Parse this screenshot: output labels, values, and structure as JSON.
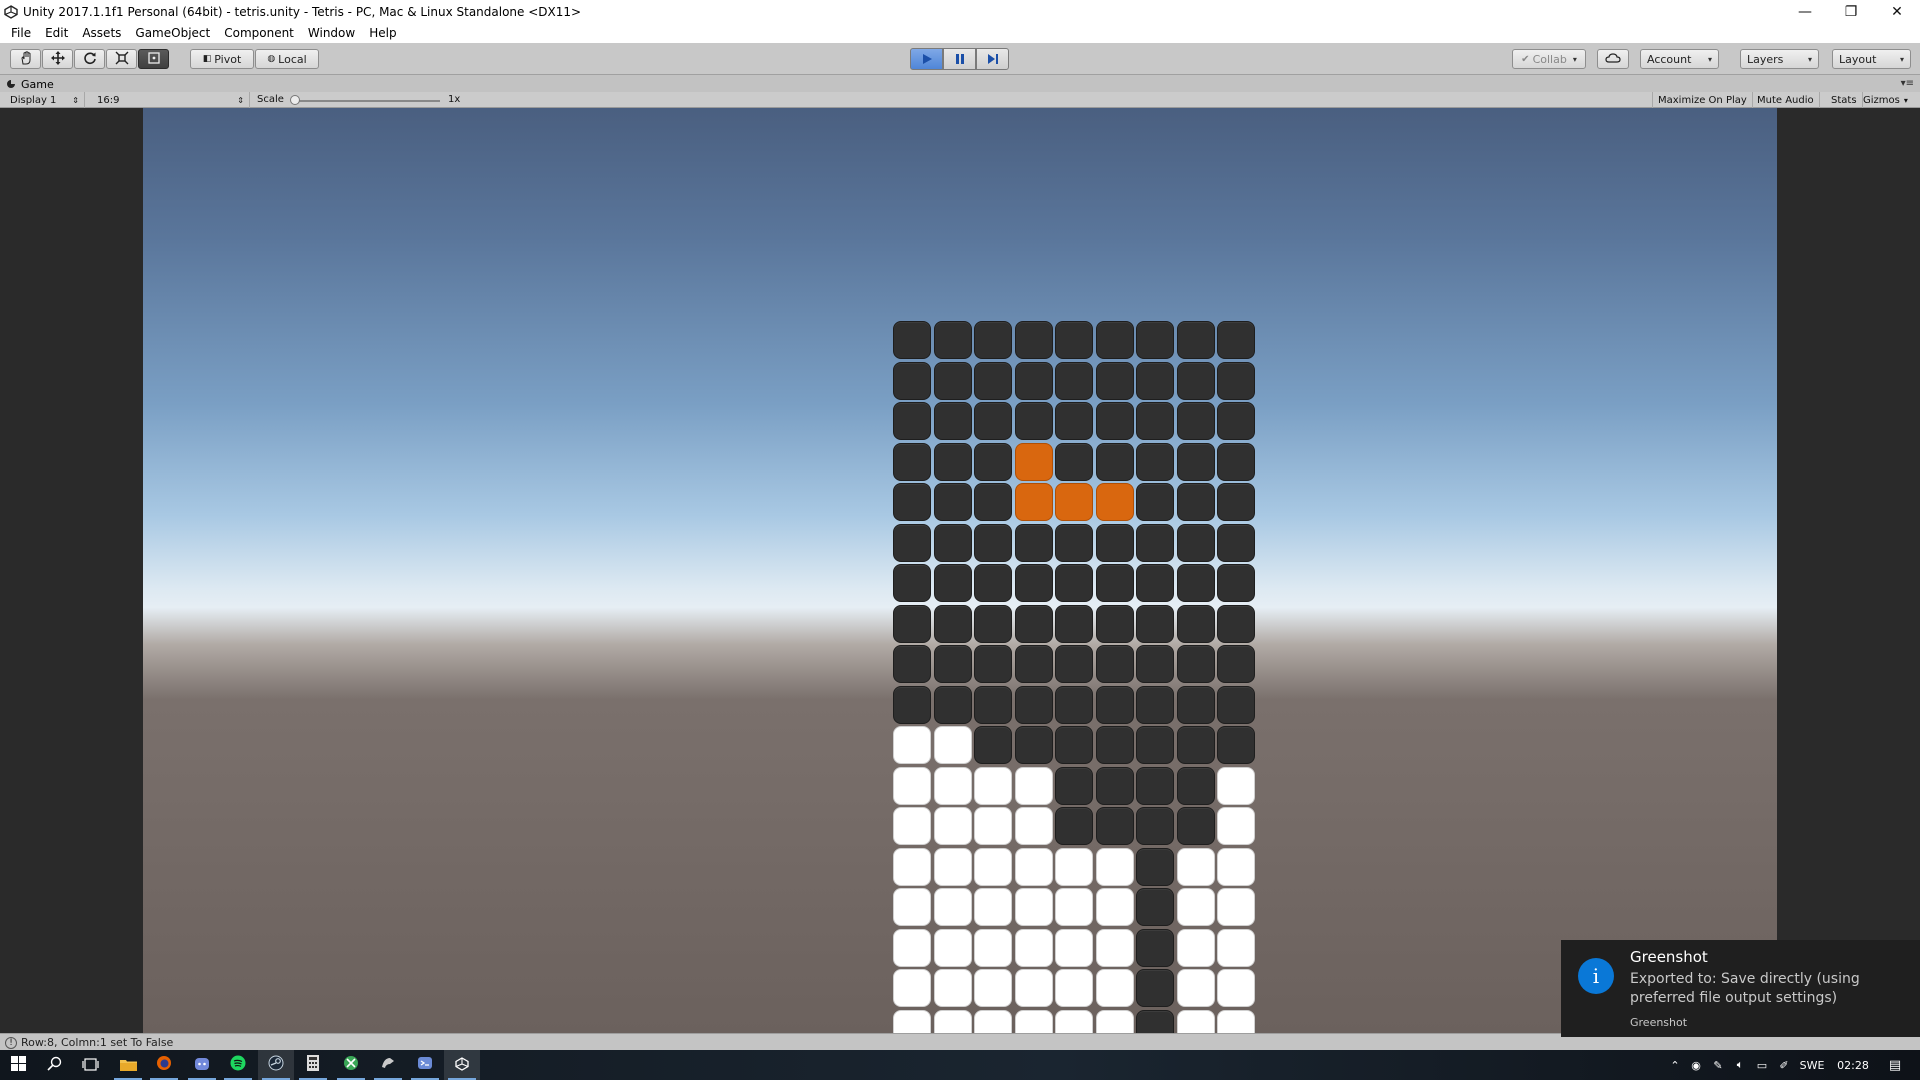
{
  "window": {
    "title": "Unity 2017.1.1f1 Personal (64bit) - tetris.unity - Tetris - PC, Mac & Linux Standalone <DX11>",
    "minimize_glyph": "—",
    "restore_glyph": "❐",
    "close_glyph": "✕"
  },
  "menu": [
    "File",
    "Edit",
    "Assets",
    "GameObject",
    "Component",
    "Window",
    "Help"
  ],
  "toolbar": {
    "transform_tools": [
      "hand-icon",
      "move-icon",
      "rotate-icon",
      "scale-icon",
      "rect-tool-icon"
    ],
    "pivot_label": "Pivot",
    "local_label": "Local",
    "collab_label": "Collab",
    "account_label": "Account",
    "layers_label": "Layers",
    "layout_label": "Layout",
    "play_state": "playing"
  },
  "game_tab": {
    "label": "Game",
    "display": "Display 1",
    "aspect": "16:9",
    "scale_label": "Scale",
    "scale_value": "1x",
    "scale_fraction": 0.0,
    "maximize_label": "Maximize On Play",
    "mute_label": "Mute Audio",
    "stats_label": "Stats",
    "gizmos_label": "Gizmos"
  },
  "board": {
    "columns": 9,
    "rows": 18,
    "legend": {
      "0": "empty",
      "1": "filled",
      "2": "active-piece"
    },
    "grid": [
      "000000000",
      "000000000",
      "000000000",
      "000200000",
      "000222000",
      "000000000",
      "000000000",
      "000000000",
      "000000000",
      "000000000",
      "110000000",
      "111100001",
      "111100001",
      "111111011",
      "111111011",
      "111111011",
      "111111011",
      "111111011"
    ],
    "colors": {
      "empty": "#303030",
      "filled": "#ffffff",
      "active": "#d9670f"
    }
  },
  "status": {
    "message": "Row:8, Colmn:1 set To False"
  },
  "notification": {
    "title": "Greenshot",
    "body": "Exported to: Save directly (using preferred file output settings)",
    "source": "Greenshot"
  },
  "taskbar": {
    "apps": [
      "start-icon",
      "search-icon",
      "task-view-icon",
      "file-explorer-icon",
      "firefox-icon",
      "discord-icon",
      "spotify-icon",
      "steam-icon",
      "calculator-icon",
      "xbox-icon",
      "app-icon",
      "visual-studio-icon",
      "unity-icon"
    ],
    "language": "SWE",
    "time": "02:28"
  }
}
